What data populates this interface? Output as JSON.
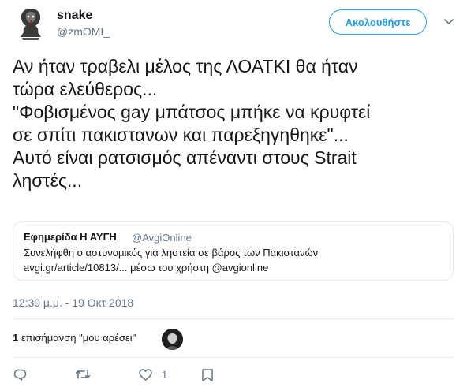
{
  "user": {
    "display_name": "snake",
    "handle": "@zmOMI_",
    "avatar": "cobra-avatar"
  },
  "header": {
    "follow_label": "Ακολουθήστε",
    "more_icon": "chevron-down-icon"
  },
  "tweet": {
    "lines": [
      "Αν ήταν τραβελι μέλος της ΛΟΑΤΚΙ  θα ήταν",
      "τώρα ελεύθερος...",
      "\"Φοβισμένος gay μπάτσος μπήκε να κρυφτεί",
      "σε σπίτι πακιστανων και παρεξηγηθηκε\"...",
      "Αυτό είναι ρατσισμός απέναντι στους Strait",
      "ληστές..."
    ]
  },
  "quote": {
    "name": "Εφημερίδα Η ΑΥΓΗ",
    "handle": "@AvgiOnline",
    "text_line1": "Συνελήφθη ο αστυνομικός για ληστεία σε βάρος των Πακιστανών",
    "text_line2": "avgi.gr/article/10813/... μέσω του χρήστη @avgionline"
  },
  "timestamp": "12:39 μ.μ. - 19 Οκτ 2018",
  "likes": {
    "count": "1",
    "label": "επισήμανση \"μου αρέσει\""
  },
  "actions": {
    "reply_icon": "reply-icon",
    "retweet_icon": "retweet-icon",
    "like_icon": "heart-icon",
    "like_count": "1",
    "dm_icon": "direct-message-icon"
  },
  "colors": {
    "accent": "#1da1f2",
    "text": "#14171a",
    "secondary": "#657786",
    "border": "#e1e8ed"
  }
}
